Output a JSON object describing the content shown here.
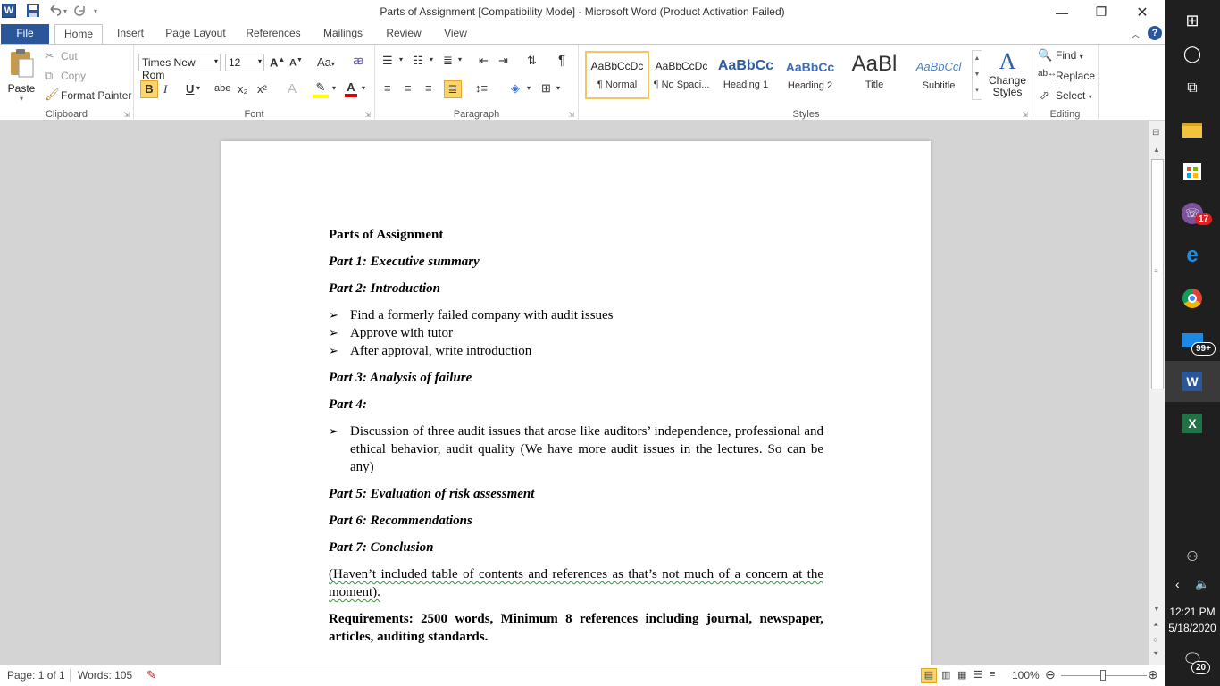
{
  "window": {
    "title": "Parts of Assignment [Compatibility Mode]  -  Microsoft Word (Product Activation Failed)"
  },
  "quick_access": {
    "logo_letter": "W"
  },
  "tabs": [
    {
      "label": "File"
    },
    {
      "label": "Home"
    },
    {
      "label": "Insert"
    },
    {
      "label": "Page Layout"
    },
    {
      "label": "References"
    },
    {
      "label": "Mailings"
    },
    {
      "label": "Review"
    },
    {
      "label": "View"
    }
  ],
  "ribbon": {
    "clipboard": {
      "paste": "Paste",
      "cut": "Cut",
      "copy": "Copy",
      "format_painter": "Format Painter",
      "label": "Clipboard"
    },
    "font": {
      "name": "Times New Rom",
      "size": "12",
      "label": "Font",
      "bold": "B",
      "italic": "I",
      "underline": "U",
      "strike": "abe",
      "sub": "x₂",
      "sup": "x²",
      "grow": "A",
      "shrink": "A",
      "case": "Aa",
      "color_letter": "A"
    },
    "paragraph": {
      "label": "Paragraph",
      "pilcrow": "¶"
    },
    "styles": {
      "label": "Styles",
      "items": [
        {
          "preview": "AaBbCcDc",
          "name": "¶ Normal"
        },
        {
          "preview": "AaBbCcDc",
          "name": "¶ No Spaci..."
        },
        {
          "preview": "AaBbCc",
          "name": "Heading 1"
        },
        {
          "preview": "AaBbCc",
          "name": "Heading 2"
        },
        {
          "preview": "AaBl",
          "name": "Title"
        },
        {
          "preview": "AaBbCcl",
          "name": "Subtitle"
        }
      ],
      "change_styles": "Change Styles"
    },
    "editing": {
      "label": "Editing",
      "find": "Find",
      "replace": "Replace",
      "select": "Select"
    }
  },
  "document": {
    "title": "Parts of Assignment",
    "part1": "Part 1: Executive summary",
    "part2": "Part 2: Introduction",
    "bullets_intro": [
      "Find a formerly failed company with audit issues",
      "Approve with tutor",
      "After approval, write introduction"
    ],
    "part3": "Part 3: Analysis of failure",
    "part4": "Part 4:",
    "bullet_part4": "Discussion of three audit issues that arose like auditors’ independence, professional and ethical behavior, audit quality (We have more audit issues in the lectures. So can be any)",
    "part5": "Part 5: Evaluation of risk assessment",
    "part6": "Part 6: Recommendations",
    "part7": "Part 7: Conclusion",
    "note": "(Haven’t included table of contents and references as that’s not much of a concern at the moment).",
    "requirements": "Requirements: 2500 words, Minimum 8 references including journal, newspaper, articles, auditing standards."
  },
  "status": {
    "page": "Page: 1 of 1",
    "words": "Words: 105",
    "zoom": "100%"
  },
  "taskbar": {
    "viber_badge": "17",
    "mail_badge": "99+",
    "time": "12:21 PM",
    "date": "5/18/2020",
    "notif_count": "20"
  },
  "colors": {
    "accent": "#2b579a",
    "style_selected": "#f2c660",
    "taskbar": "#1f1f1f"
  }
}
